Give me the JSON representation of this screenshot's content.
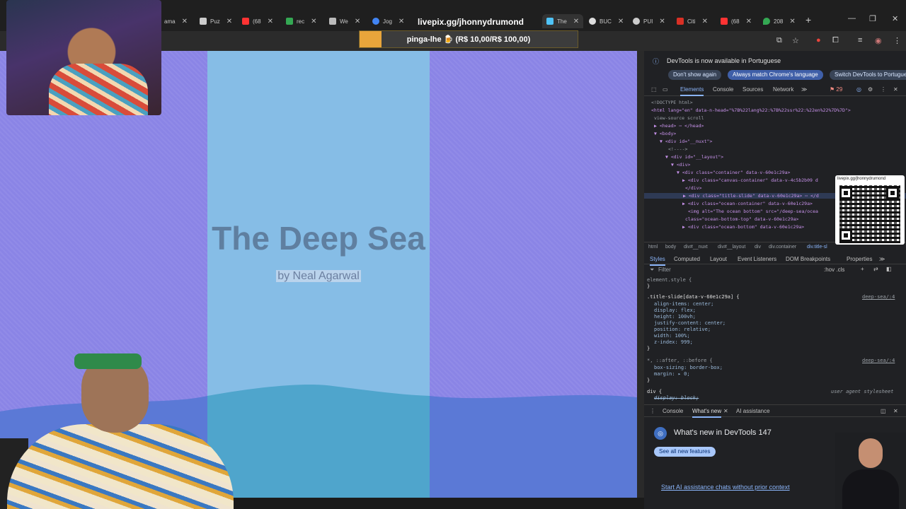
{
  "browser": {
    "tabs": [
      {
        "label": "ama",
        "favicon": "#888888"
      },
      {
        "label": "Puz",
        "favicon": "#cccccc"
      },
      {
        "label": "(68",
        "favicon": "#ff3333"
      },
      {
        "label": "rec",
        "favicon": "#34a853"
      },
      {
        "label": "We",
        "favicon": "#bbbbbb"
      },
      {
        "label": "Jog",
        "favicon": "#4285f4"
      },
      {
        "label": "livepix.gg/jhonnydrumond",
        "favicon": "#e8453c"
      },
      {
        "label": "The",
        "favicon": "#4fc3f7",
        "active": true
      },
      {
        "label": "BUC",
        "favicon": "#dddddd"
      },
      {
        "label": "PUI",
        "favicon": "#cccccc"
      },
      {
        "label": "Citi",
        "favicon": "#d93025"
      },
      {
        "label": "(68",
        "favicon": "#ff3333"
      },
      {
        "label": "208",
        "favicon": "#34a853"
      }
    ],
    "new_tab": "+",
    "window_controls": {
      "minimize": "—",
      "maximize": "❐",
      "close": "✕"
    }
  },
  "stream_overlay": {
    "livepix_url": "livepix.gg/jhonnydrumond",
    "donation_text": "pinga-lhe 🍺 (R$ 10,00/R$ 100,00)",
    "donation_progress": 0.1,
    "qr_label": "livepix.gg/jhonnydrumond"
  },
  "page": {
    "title": "The Deep Sea",
    "byline": "by Neal Agarwal"
  },
  "devtools": {
    "info_message": "DevTools is now available in Portuguese",
    "info_buttons": [
      "Don't show again",
      "Always match Chrome's language",
      "Switch DevTools to Portuguese"
    ],
    "main_tabs": [
      "Elements",
      "Console",
      "Sources",
      "Network"
    ],
    "issues_count": "29",
    "dom_lines": [
      "<!DOCTYPE html>",
      "<html lang=\"en\" data-n-head=\"%7B%22lang%22:%7B%22ssr%22:%22en%22%7D%7D\">",
      "view-source  scroll",
      "▶ <head> ⋯ </head>",
      "▼ <body>",
      "▼ <div id=\"__nuxt\">",
      "<!---->",
      "▼ <div id=\"__layout\">",
      "▼ <div>",
      "▼ <div class=\"container\" data-v-60e1c29a>",
      "▶ <div class=\"canvas-container\" data-v-4c5b2b09 d",
      "</div>",
      "▶ <div class=\"title-slide\" data-v-60e1c29a> ⋯ </d",
      "▶ <div class=\"ocean-container\" data-v-60e1c29a>",
      "<img alt=\"The ocean bottom\" src=\"/deep-sea/ocea",
      "class=\"ocean-bottom-top\" data-v-60e1c29a>",
      "▶ <div class=\"ocean-bottom\" data-v-60e1c29a>"
    ],
    "breadcrumbs": [
      "html",
      "body",
      "div#__nuxt",
      "div#__layout",
      "div",
      "div.container",
      "div.title-sl"
    ],
    "style_tabs": [
      "Styles",
      "Computed",
      "Layout",
      "Event Listeners",
      "DOM Breakpoints",
      "Properties"
    ],
    "filter_placeholder": "Filter",
    "filter_tools": ":hov .cls",
    "element_style": "element.style {",
    "rule_selector": ".title-slide[data-v-60e1c29a] {",
    "rule_source": "deep-sea/:4",
    "rule_props": [
      "align-items: center;",
      "display: flex;",
      "height: 100vh;",
      "justify-content: center;",
      "position: relative;",
      "width: 100%;",
      "z-index: 999;"
    ],
    "rule2_selector": "*, ::after, ::before {",
    "rule2_source": "deep-sea/:4",
    "rule2_props": [
      "box-sizing: border-box;",
      "margin: ▸ 0;"
    ],
    "rule3_selector": "div {",
    "rule3_source": "user agent stylesheet",
    "rule3_prop": "display: block;",
    "drawer_tabs": [
      "Console",
      "What's new",
      "AI assistance"
    ],
    "whats_new_title": "What's new in DevTools 147",
    "see_all": "See all new features",
    "ai_link": "Start AI assistance chats without prior context"
  }
}
